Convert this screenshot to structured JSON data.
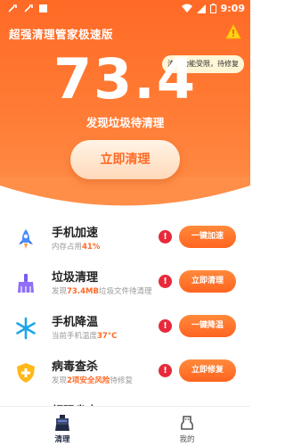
{
  "status_bar": {
    "time": "9:09"
  },
  "header": {
    "app_title": "超强清理管家极速版",
    "tooltip": "清理功能受限，待修复"
  },
  "hero": {
    "junk_value": "73.4",
    "subtitle": "发现垃圾待清理",
    "clean_button": "立即清理"
  },
  "items": [
    {
      "title": "手机加速",
      "sub_prefix": "内存占用",
      "sub_highlight": "41%",
      "sub_suffix": "",
      "alert": "!",
      "action": "一键加速",
      "icon": "rocket-icon"
    },
    {
      "title": "垃圾清理",
      "sub_prefix": "发现",
      "sub_highlight": "73.4MB",
      "sub_suffix": "垃圾文件待清理",
      "alert": "!",
      "action": "立即清理",
      "icon": "broom-icon"
    },
    {
      "title": "手机降温",
      "sub_prefix": "当前手机温度",
      "sub_highlight": "37°C",
      "sub_suffix": "",
      "alert": "!",
      "action": "一键降温",
      "icon": "snowflake-icon"
    },
    {
      "title": "病毒查杀",
      "sub_prefix": "发现",
      "sub_highlight": "2项安全风险",
      "sub_suffix": "待修复",
      "alert": "!",
      "action": "立即修复",
      "icon": "shield-plus-icon"
    },
    {
      "title": "超强省电",
      "sub_prefix": "",
      "sub_highlight": "",
      "sub_suffix": "",
      "alert": "",
      "action": "",
      "icon": "battery-icon"
    }
  ],
  "tabbar": {
    "clean_label": "清理",
    "mine_label": "我的"
  },
  "colors": {
    "brand_orange": "#ff6a26",
    "alert_red": "#e8293a",
    "tab_active": "#1f2a44"
  }
}
